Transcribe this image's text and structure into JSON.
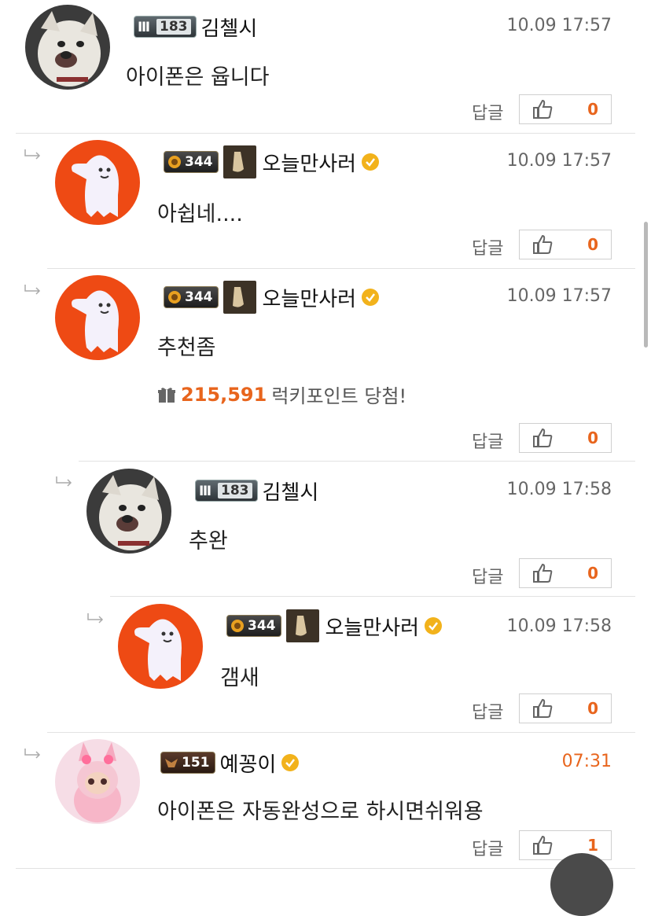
{
  "comments": [
    {
      "nick": "김첼시",
      "level": "183",
      "time": "10.09 17:57",
      "text": "아이폰은 윱니다",
      "reply": "답글",
      "likes": "0"
    },
    {
      "nick": "오늘만사러",
      "level": "344",
      "time": "10.09 17:57",
      "text": "아쉽네....",
      "reply": "답글",
      "likes": "0"
    },
    {
      "nick": "오늘만사러",
      "level": "344",
      "time": "10.09 17:57",
      "text": "추천좀",
      "reply": "답글",
      "likes": "0",
      "lucky": {
        "points": "215,591",
        "label": "럭키포인트 당첨!"
      }
    },
    {
      "nick": "김첼시",
      "level": "183",
      "time": "10.09 17:58",
      "text": "추완",
      "reply": "답글",
      "likes": "0"
    },
    {
      "nick": "오늘만사러",
      "level": "344",
      "time": "10.09 17:58",
      "text": "갬새",
      "reply": "답글",
      "likes": "0"
    },
    {
      "nick": "예꽁이",
      "level": "151",
      "time": "07:31",
      "text": "아이폰은 자동완성으로 하시면쉬워용",
      "reply": "답글",
      "likes": "1"
    }
  ],
  "colors": {
    "accent": "#e8651d",
    "verified": "#f2b21b",
    "avatar_orange": "#ee4a14"
  },
  "icons": [
    "reply-arrow-icon",
    "level-badge-icon",
    "verified-icon",
    "thumbs-up-icon",
    "gift-icon"
  ]
}
